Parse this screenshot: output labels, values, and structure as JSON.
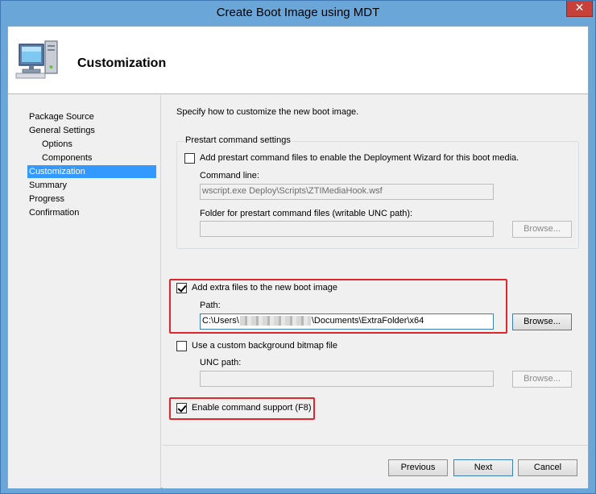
{
  "window": {
    "title": "Create Boot Image using MDT",
    "close_glyph": "✕"
  },
  "header": {
    "title": "Customization",
    "icon": "computer-icon"
  },
  "nav": {
    "items": [
      {
        "label": "Package Source",
        "level": 0,
        "selected": false
      },
      {
        "label": "General Settings",
        "level": 0,
        "selected": false
      },
      {
        "label": "Options",
        "level": 1,
        "selected": false
      },
      {
        "label": "Components",
        "level": 1,
        "selected": false
      },
      {
        "label": "Customization",
        "level": 0,
        "selected": true
      },
      {
        "label": "Summary",
        "level": 0,
        "selected": false
      },
      {
        "label": "Progress",
        "level": 0,
        "selected": false
      },
      {
        "label": "Confirmation",
        "level": 0,
        "selected": false
      }
    ]
  },
  "main": {
    "instruction": "Specify how to customize the new boot image.",
    "prestart": {
      "group_label": "Prestart command settings",
      "checkbox_label": "Add prestart command files to enable the Deployment Wizard for this boot media.",
      "checked": false,
      "command_line_label": "Command line:",
      "command_line_value": "wscript.exe Deploy\\Scripts\\ZTIMediaHook.wsf",
      "folder_label": "Folder for prestart command files (writable UNC path):",
      "folder_value": "",
      "browse_label": "Browse..."
    },
    "extra_files": {
      "checkbox_label": "Add extra files to the new boot image",
      "checked": true,
      "path_label": "Path:",
      "path_prefix": "C:\\Users\\",
      "path_suffix": "\\Documents\\ExtraFolder\\x64",
      "browse_label": "Browse..."
    },
    "background": {
      "checkbox_label": "Use a custom background bitmap file",
      "checked": false,
      "unc_label": "UNC path:",
      "unc_value": "",
      "browse_label": "Browse..."
    },
    "command_support": {
      "checkbox_label": "Enable command support (F8)",
      "checked": true
    },
    "highlight_color": "#e0262b"
  },
  "footer": {
    "previous_label": "Previous",
    "next_label": "Next",
    "cancel_label": "Cancel"
  }
}
